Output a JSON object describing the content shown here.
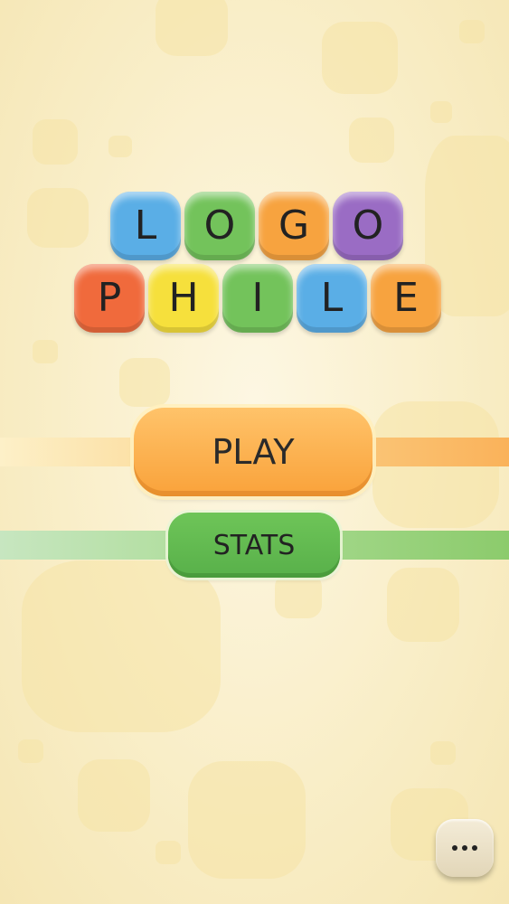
{
  "logo": {
    "row1": [
      {
        "letter": "L",
        "color": "#5aaee6"
      },
      {
        "letter": "O",
        "color": "#73c35b"
      },
      {
        "letter": "G",
        "color": "#f7a33f"
      },
      {
        "letter": "O",
        "color": "#9a6cc4"
      }
    ],
    "row2": [
      {
        "letter": "P",
        "color": "#f06a3c"
      },
      {
        "letter": "H",
        "color": "#f6e03c"
      },
      {
        "letter": "I",
        "color": "#73c35b"
      },
      {
        "letter": "L",
        "color": "#5aaee6"
      },
      {
        "letter": "E",
        "color": "#f7a33f"
      }
    ]
  },
  "menu": {
    "play_label": "PLAY",
    "stats_label": "STATS"
  },
  "more_button": {
    "icon": "ellipsis-icon"
  },
  "colors": {
    "play_band": "#fbc36f",
    "stats_band": "#8fd07a",
    "background": "#f9eec8"
  }
}
